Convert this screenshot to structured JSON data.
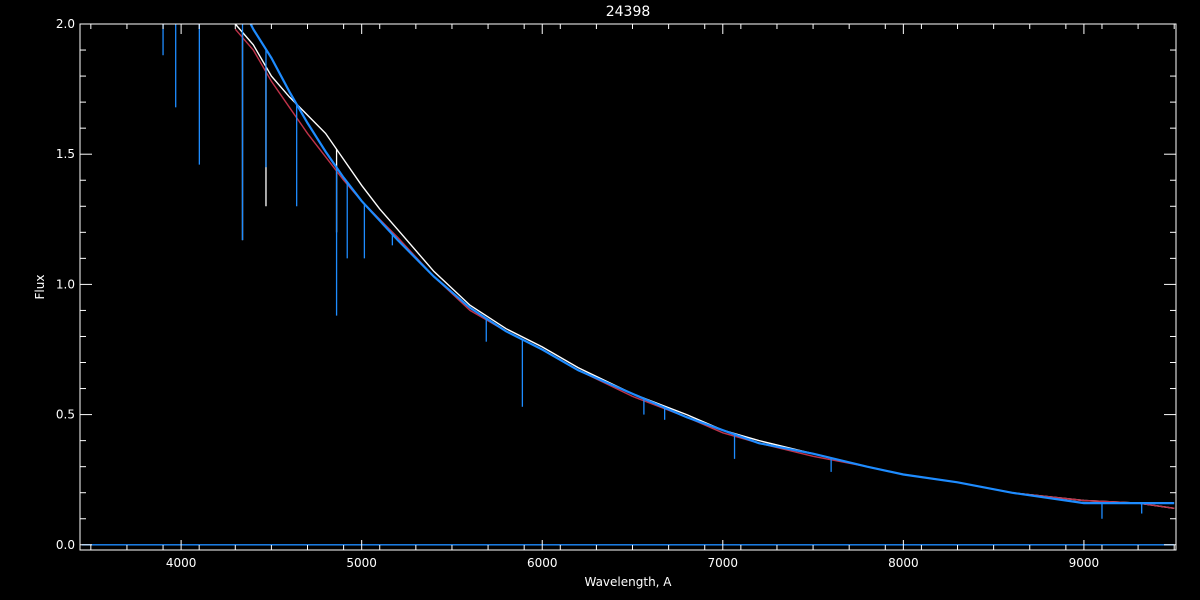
{
  "chart_data": {
    "type": "line",
    "title": "24398",
    "xlabel": "Wavelength, A",
    "ylabel": "Flux",
    "xlim": [
      3440,
      9510
    ],
    "ylim": [
      -0.02,
      2.0
    ],
    "x_ticks": [
      4000,
      5000,
      6000,
      7000,
      8000,
      9000
    ],
    "x_tick_labels": [
      "4000",
      "5000",
      "6000",
      "7000",
      "8000",
      "9000"
    ],
    "y_ticks": [
      0.0,
      0.5,
      1.0,
      1.5,
      2.0
    ],
    "y_tick_labels": [
      "0.0",
      "0.5",
      "1.0",
      "1.5",
      "2.0"
    ],
    "grid": false,
    "colors": {
      "background": "#000000",
      "axes": "#ffffff",
      "observed": "#ffffff",
      "model_red": "#c0334a",
      "model_blue": "#1e8cff"
    },
    "series": [
      {
        "color": "#ffffff",
        "x": [
          4200,
          4300,
          4400,
          4500,
          4600,
          4700,
          4800,
          4900,
          5000,
          5100,
          5200,
          5400,
          5600,
          5800,
          6000,
          6200,
          6500,
          6800,
          7000,
          7200,
          7500,
          7800,
          8000,
          8300,
          8600,
          9000,
          9300,
          9500
        ],
        "y": [
          2.05,
          2.0,
          1.92,
          1.8,
          1.72,
          1.65,
          1.58,
          1.48,
          1.38,
          1.29,
          1.21,
          1.05,
          0.92,
          0.83,
          0.76,
          0.68,
          0.58,
          0.5,
          0.44,
          0.4,
          0.35,
          0.3,
          0.27,
          0.24,
          0.2,
          0.17,
          0.16,
          0.14
        ],
        "absorption_lines": [
          {
            "x": 4340,
            "y_min": 1.17
          },
          {
            "x": 4470,
            "y_min": 1.3
          },
          {
            "x": 4861,
            "y_min": 1.2
          }
        ]
      },
      {
        "color": "#c0334a",
        "x": [
          4300,
          4400,
          4500,
          4600,
          4700,
          4800,
          4900,
          5000,
          5200,
          5400,
          5600,
          5800,
          6000,
          6200,
          6500,
          6800,
          7000,
          7200,
          7500,
          7800,
          8000,
          8300,
          8600,
          9000,
          9300,
          9500
        ],
        "y": [
          1.98,
          1.9,
          1.78,
          1.68,
          1.58,
          1.49,
          1.4,
          1.32,
          1.18,
          1.03,
          0.9,
          0.82,
          0.75,
          0.67,
          0.57,
          0.49,
          0.43,
          0.39,
          0.34,
          0.3,
          0.27,
          0.24,
          0.2,
          0.17,
          0.16,
          0.14
        ]
      },
      {
        "color": "#1e8cff",
        "x": [
          4350,
          4400,
          4500,
          4600,
          4700,
          4800,
          4900,
          5000,
          5200,
          5400,
          5600,
          5800,
          6000,
          6200,
          6500,
          6800,
          7000,
          7200,
          7500,
          7800,
          8000,
          8300,
          8600,
          9000,
          9300,
          9500
        ],
        "y": [
          2.05,
          1.98,
          1.87,
          1.74,
          1.62,
          1.51,
          1.41,
          1.32,
          1.17,
          1.03,
          0.91,
          0.82,
          0.75,
          0.67,
          0.58,
          0.49,
          0.44,
          0.39,
          0.35,
          0.3,
          0.27,
          0.24,
          0.2,
          0.16,
          0.16,
          0.16
        ],
        "absorption_lines": [
          {
            "x": 3900,
            "y_min": 1.88
          },
          {
            "x": 3970,
            "y_min": 1.68
          },
          {
            "x": 4101,
            "y_min": 1.46
          },
          {
            "x": 4340,
            "y_min": 1.17
          },
          {
            "x": 4470,
            "y_min": 1.45
          },
          {
            "x": 4640,
            "y_min": 1.3
          },
          {
            "x": 4861,
            "y_min": 0.88
          },
          {
            "x": 4920,
            "y_min": 1.1
          },
          {
            "x": 5015,
            "y_min": 1.1
          },
          {
            "x": 5170,
            "y_min": 1.15
          },
          {
            "x": 5690,
            "y_min": 0.78
          },
          {
            "x": 5890,
            "y_min": 0.53
          },
          {
            "x": 6563,
            "y_min": 0.5
          },
          {
            "x": 6678,
            "y_min": 0.48
          },
          {
            "x": 7065,
            "y_min": 0.33
          },
          {
            "x": 7600,
            "y_min": 0.28
          },
          {
            "x": 9100,
            "y_min": 0.1
          },
          {
            "x": 9320,
            "y_min": 0.12
          }
        ]
      },
      {
        "color": "#1e8cff",
        "x": [
          3450,
          9500
        ],
        "y": [
          0.0,
          0.0
        ]
      }
    ]
  }
}
